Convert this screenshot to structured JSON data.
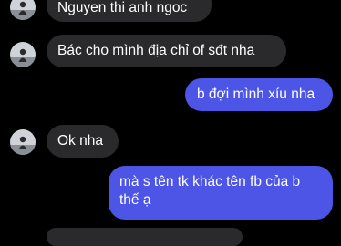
{
  "colors": {
    "background": "#000000",
    "incoming_bubble": "#2a2a2d",
    "outgoing_bubble": "#4d55e6",
    "text": "#ffffff"
  },
  "messages": [
    {
      "direction": "incoming",
      "text": "Nguyen thi anh ngoc",
      "avatar": true
    },
    {
      "direction": "incoming",
      "text": "Bác cho mình địa chỉ of sđt nha",
      "avatar": true
    },
    {
      "direction": "outgoing",
      "text": "b đợi mình xíu nha"
    },
    {
      "direction": "incoming",
      "text": "Ok nha",
      "avatar": true
    },
    {
      "direction": "outgoing",
      "text": "mà s tên tk khác tên fb của b thế ạ"
    },
    {
      "direction": "incoming",
      "text": ""
    }
  ]
}
